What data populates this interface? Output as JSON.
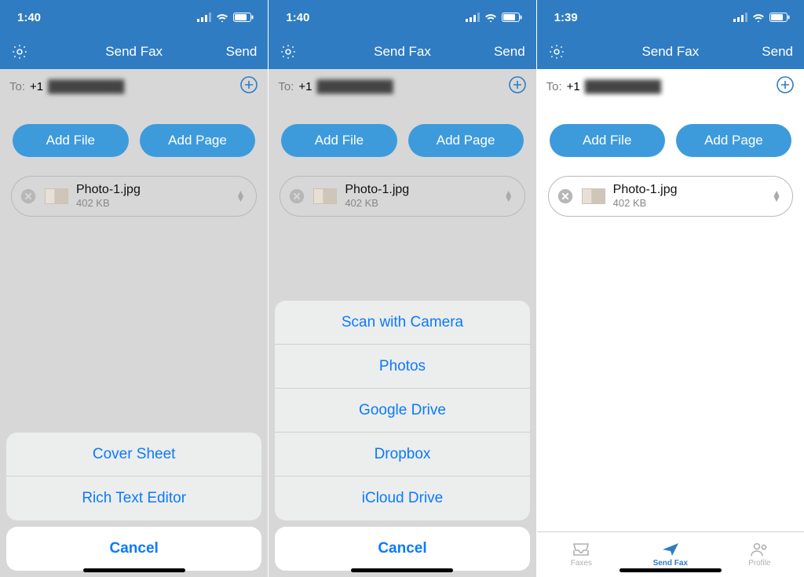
{
  "colors": {
    "primary": "#2f7cc3",
    "accent": "#3d9bdc",
    "link": "#0a7aff"
  },
  "screens": [
    {
      "status_time": "1:40",
      "nav": {
        "title": "Send Fax",
        "right": "Send"
      },
      "to": {
        "label": "To:",
        "prefix": "+1",
        "rest": "██████████"
      },
      "buttons": {
        "add_file": "Add File",
        "add_page": "Add Page"
      },
      "file": {
        "name": "Photo-1.jpg",
        "size": "402 KB"
      },
      "sheet": {
        "items": [
          "Cover Sheet",
          "Rich Text Editor"
        ],
        "cancel": "Cancel"
      }
    },
    {
      "status_time": "1:40",
      "nav": {
        "title": "Send Fax",
        "right": "Send"
      },
      "to": {
        "label": "To:",
        "prefix": "+1",
        "rest": "██████████"
      },
      "buttons": {
        "add_file": "Add File",
        "add_page": "Add Page"
      },
      "file": {
        "name": "Photo-1.jpg",
        "size": "402 KB"
      },
      "sheet": {
        "items": [
          "Scan with Camera",
          "Photos",
          "Google Drive",
          "Dropbox",
          "iCloud Drive"
        ],
        "cancel": "Cancel"
      }
    },
    {
      "status_time": "1:39",
      "nav": {
        "title": "Send Fax",
        "right": "Send"
      },
      "to": {
        "label": "To:",
        "prefix": "+1",
        "rest": "██████████"
      },
      "buttons": {
        "add_file": "Add File",
        "add_page": "Add Page"
      },
      "file": {
        "name": "Photo-1.jpg",
        "size": "402 KB"
      },
      "tabs": [
        {
          "label": "Faxes",
          "active": false
        },
        {
          "label": "Send Fax",
          "active": true
        },
        {
          "label": "Profile",
          "active": false
        }
      ]
    }
  ]
}
